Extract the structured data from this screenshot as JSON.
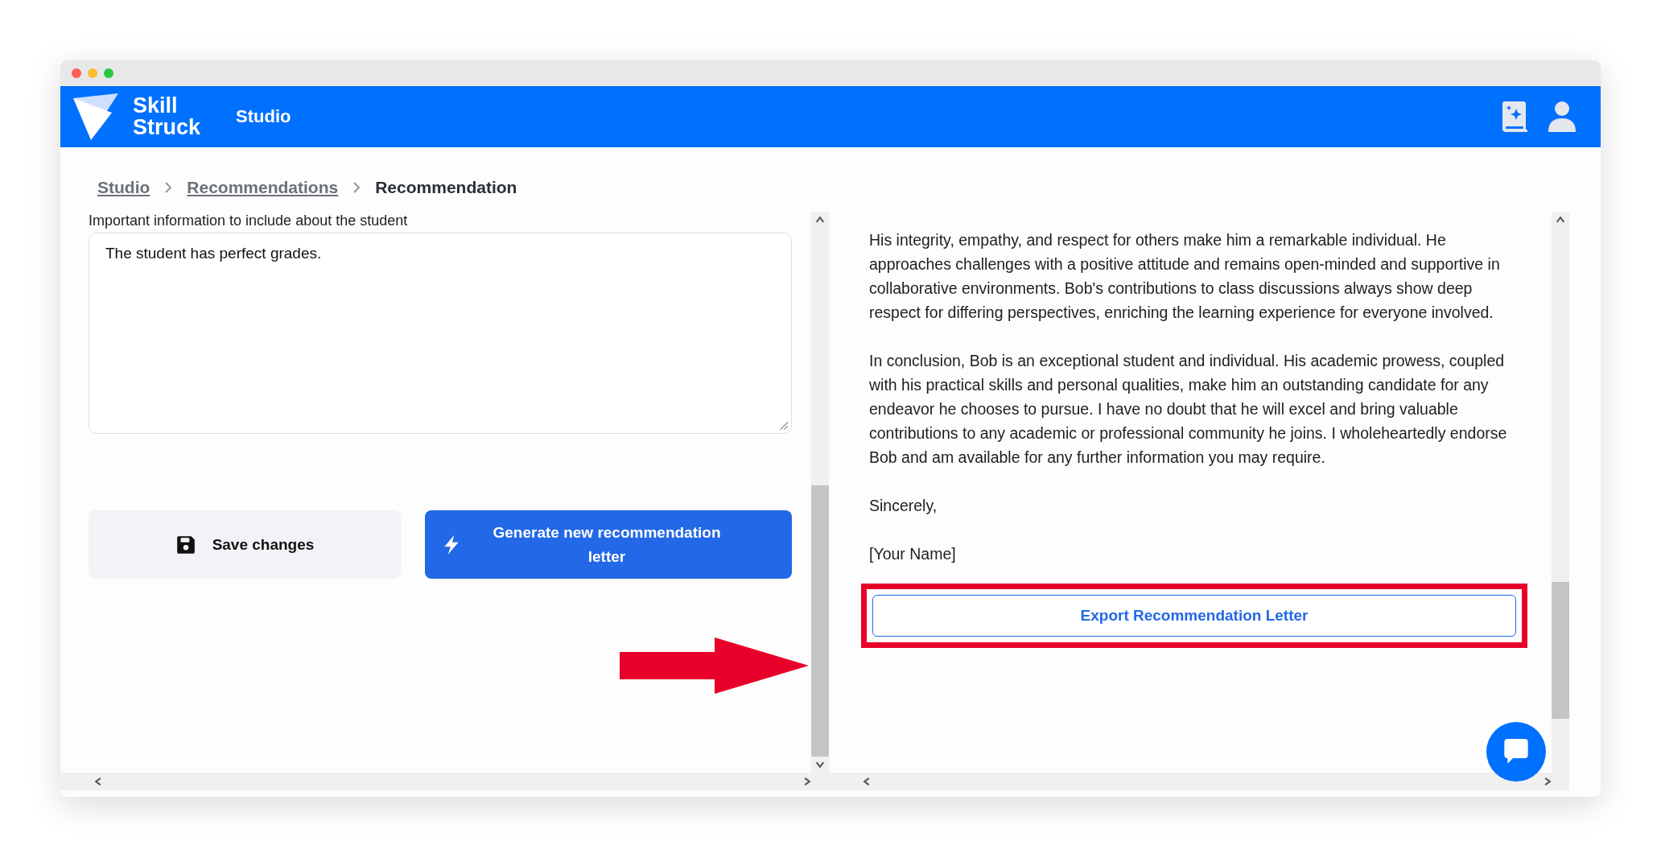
{
  "header": {
    "logo_lines": [
      "Skill",
      "Struck"
    ],
    "title": "Studio"
  },
  "breadcrumb": [
    {
      "label": "Studio",
      "kind": "link"
    },
    {
      "label": "Recommendations",
      "kind": "link"
    },
    {
      "label": "Recommendation",
      "kind": "current"
    }
  ],
  "form": {
    "field_label": "Important information to include about the student",
    "field_value": "The student has perfect grades.",
    "save_button": "Save changes",
    "generate_button": "Generate new recommendation letter"
  },
  "letter": {
    "paragraphs": [
      "His integrity, empathy, and respect for others make him a remarkable individual. He approaches challenges with a positive attitude and remains open-minded and supportive in collaborative environments. Bob's contributions to class discussions always show deep respect for differing perspectives, enriching the learning experience for everyone involved.",
      "In conclusion, Bob is an exceptional student and individual. His academic prowess, coupled with his practical skills and personal qualities, make him an outstanding candidate for any endeavor he chooses to pursue. I have no doubt that he will excel and bring valuable contributions to any academic or professional community he joins. I wholeheartedly endorse Bob and am available for any further information you may require.",
      "Sincerely,",
      "[Your Name]"
    ],
    "export_button": "Export Recommendation Letter"
  }
}
